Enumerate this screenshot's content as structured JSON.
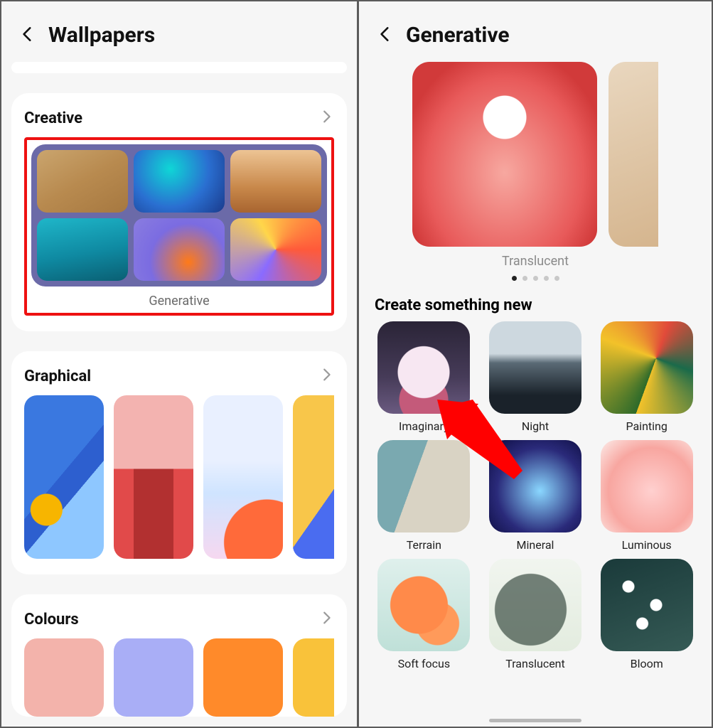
{
  "left": {
    "title": "Wallpapers",
    "sections": {
      "creative": {
        "title": "Creative",
        "primary_tile_caption": "Generative"
      },
      "graphical": {
        "title": "Graphical"
      },
      "colours": {
        "title": "Colours"
      }
    },
    "highlight_color": "#e11"
  },
  "right": {
    "title": "Generative",
    "hero_caption": "Translucent",
    "dots_total": 5,
    "dots_active_index": 0,
    "create_heading": "Create something new",
    "categories": [
      {
        "label": "Imaginary"
      },
      {
        "label": "Night"
      },
      {
        "label": "Painting"
      },
      {
        "label": "Terrain"
      },
      {
        "label": "Mineral"
      },
      {
        "label": "Luminous"
      },
      {
        "label": "Soft focus"
      },
      {
        "label": "Translucent"
      },
      {
        "label": "Bloom"
      }
    ]
  }
}
